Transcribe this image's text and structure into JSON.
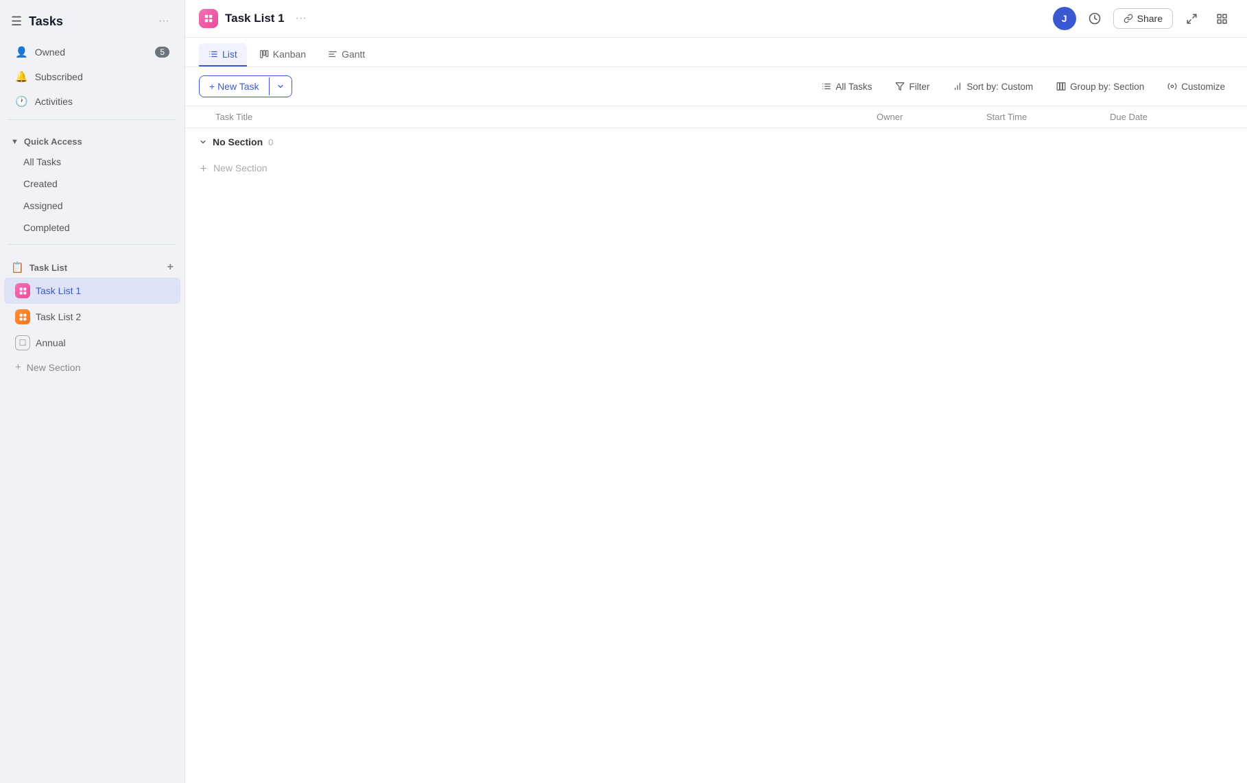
{
  "sidebar": {
    "title": "Tasks",
    "nav": [
      {
        "id": "owned",
        "label": "Owned",
        "badge": "5",
        "icon": "👤"
      },
      {
        "id": "subscribed",
        "label": "Subscribed",
        "badge": null,
        "icon": "🔔"
      },
      {
        "id": "activities",
        "label": "Activities",
        "badge": null,
        "icon": "🕐"
      }
    ],
    "quickAccess": {
      "label": "Quick Access",
      "items": [
        {
          "id": "all-tasks",
          "label": "All Tasks"
        },
        {
          "id": "created",
          "label": "Created"
        },
        {
          "id": "assigned",
          "label": "Assigned"
        },
        {
          "id": "completed",
          "label": "Completed"
        }
      ]
    },
    "taskList": {
      "label": "Task List",
      "items": [
        {
          "id": "task-list-1",
          "label": "Task List 1",
          "iconType": "pink",
          "active": true
        },
        {
          "id": "task-list-2",
          "label": "Task List 2",
          "iconType": "orange",
          "active": false
        },
        {
          "id": "annual",
          "label": "Annual",
          "iconType": "gray",
          "active": false
        }
      ],
      "newSectionLabel": "New Section"
    }
  },
  "header": {
    "title": "Task List 1",
    "iconType": "pink",
    "avatar": "J",
    "shareLabel": "Share"
  },
  "tabs": [
    {
      "id": "list",
      "label": "List",
      "active": true
    },
    {
      "id": "kanban",
      "label": "Kanban",
      "active": false
    },
    {
      "id": "gantt",
      "label": "Gantt",
      "active": false
    }
  ],
  "toolbar": {
    "newTaskLabel": "+ New Task",
    "allTasksLabel": "All Tasks",
    "filterLabel": "Filter",
    "sortLabel": "Sort by: Custom",
    "groupLabel": "Group by: Section",
    "customizeLabel": "Customize"
  },
  "columns": {
    "taskTitle": "Task Title",
    "owner": "Owner",
    "startTime": "Start Time",
    "dueDate": "Due Date"
  },
  "content": {
    "sections": [
      {
        "id": "no-section",
        "label": "No Section",
        "count": "0",
        "collapsed": false,
        "tasks": []
      }
    ],
    "addSectionLabel": "New Section"
  }
}
